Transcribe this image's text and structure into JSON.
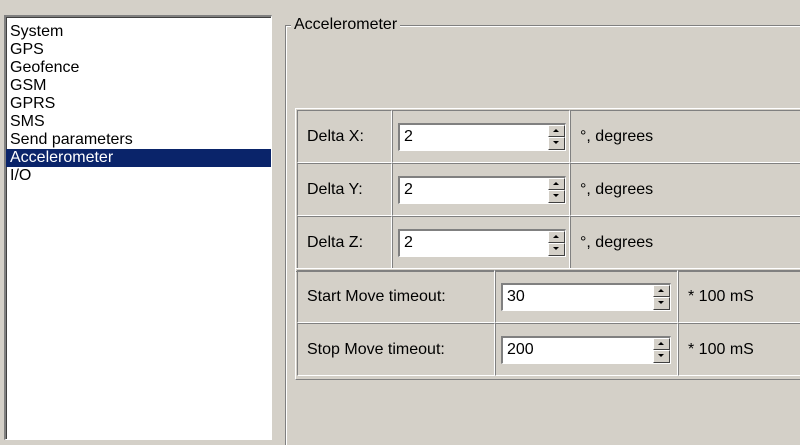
{
  "nav": {
    "items": [
      {
        "label": "System",
        "selected": false
      },
      {
        "label": "GPS",
        "selected": false
      },
      {
        "label": "Geofence",
        "selected": false
      },
      {
        "label": "GSM",
        "selected": false
      },
      {
        "label": "GPRS",
        "selected": false
      },
      {
        "label": "SMS",
        "selected": false
      },
      {
        "label": "Send parameters",
        "selected": false
      },
      {
        "label": "Accelerometer",
        "selected": true
      },
      {
        "label": "I/O",
        "selected": false
      }
    ]
  },
  "group": {
    "title": "Accelerometer"
  },
  "delta": {
    "x": {
      "label": "Delta X:",
      "value": "2",
      "unit": "°, degrees"
    },
    "y": {
      "label": "Delta Y:",
      "value": "2",
      "unit": "°, degrees"
    },
    "z": {
      "label": "Delta Z:",
      "value": "2",
      "unit": "°, degrees"
    }
  },
  "move": {
    "start": {
      "label": "Start Move timeout:",
      "value": "30",
      "unit": "* 100 mS"
    },
    "stop": {
      "label": "Stop Move timeout:",
      "value": "200",
      "unit": "* 100 mS"
    }
  },
  "colors": {
    "face": "#d4d0c8",
    "selection": "#0a246a"
  }
}
